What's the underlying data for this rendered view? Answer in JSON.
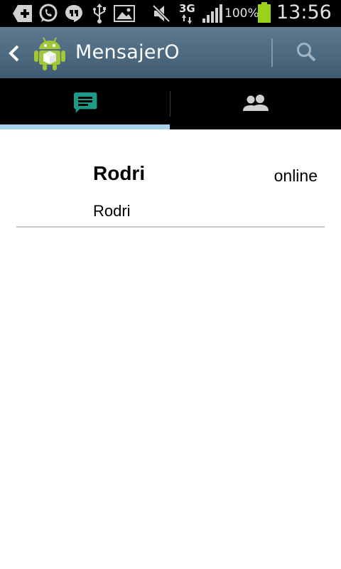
{
  "status_bar": {
    "battery": "100%",
    "network": "3G",
    "time": "13:56",
    "icons": [
      "add-icon",
      "whatsapp-icon",
      "hangouts-icon",
      "usb-icon",
      "gallery-icon",
      "mute-icon",
      "network-3g-icon",
      "signal-icon",
      "battery-icon"
    ],
    "battery_color": "#9bd11a"
  },
  "action_bar": {
    "title": "MensajerO",
    "back_icon": "back-chevron-icon",
    "app_icon": "android-icon",
    "search_icon": "search-icon",
    "background_color": "#4c6a81"
  },
  "tabs": [
    {
      "icon": "chat-icon",
      "selected": true,
      "icon_color": "#1e9a89"
    },
    {
      "icon": "contacts-icon",
      "selected": false,
      "icon_color": "#cfcfcf"
    }
  ],
  "conversations": [
    {
      "name": "Rodri",
      "status": "online",
      "message": "Rodri"
    }
  ],
  "colors": {
    "tab_indicator": "#a7d3ef"
  }
}
